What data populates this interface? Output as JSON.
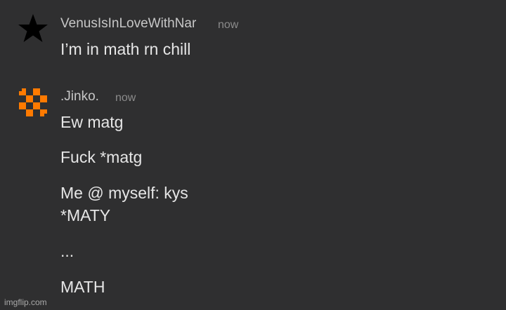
{
  "messages": [
    {
      "username": "VenusIsInLoveWithNar",
      "timestamp": "now",
      "avatar_icon": "black-star-icon",
      "lines": [
        "I’m in math rn chill"
      ]
    },
    {
      "username": ".Jinko.",
      "timestamp": "now",
      "avatar_icon": "orange-pixel-checker-icon",
      "avatar_color": "#ff7a00",
      "lines": [
        "Ew matg",
        "Fuck *matg",
        "Me @ myself: kys",
        "*MATY",
        "...",
        "MATH"
      ]
    }
  ],
  "watermark": "imgflip.com"
}
